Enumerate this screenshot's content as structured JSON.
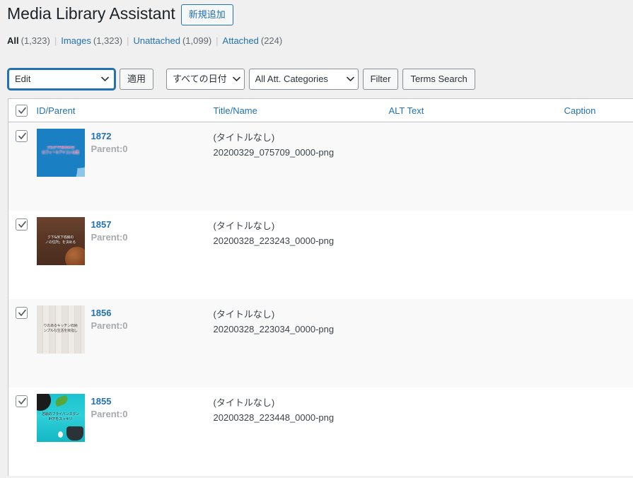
{
  "header": {
    "title": "Media Library Assistant",
    "add_new_label": "新規追加"
  },
  "status_links": {
    "items": [
      {
        "label": "All",
        "count": "(1,323)",
        "current": true
      },
      {
        "label": "Images",
        "count": "(1,323)",
        "current": false
      },
      {
        "label": "Unattached",
        "count": "(1,099)",
        "current": false
      },
      {
        "label": "Attached",
        "count": "(224)",
        "current": false
      }
    ],
    "separator": "|"
  },
  "tablenav": {
    "bulk_action": {
      "value": "Edit",
      "name": "bulk-action-select"
    },
    "apply_label": "適用",
    "date_filter": {
      "value": "すべての日付"
    },
    "category_filter": {
      "value": "All Att. Categories"
    },
    "filter_label": "Filter",
    "terms_search_label": "Terms Search"
  },
  "table": {
    "columns": [
      {
        "key": "cb",
        "label": ""
      },
      {
        "key": "id",
        "label": "ID/Parent"
      },
      {
        "key": "title",
        "label": "Title/Name"
      },
      {
        "key": "alt",
        "label": "ALT Text"
      },
      {
        "key": "caption",
        "label": "Caption"
      }
    ],
    "rows": [
      {
        "checked": true,
        "id": "1872",
        "parent": "Parent:0",
        "title": "(タイトルなし)",
        "name": "20200329_075709_0000-png",
        "alt": "",
        "caption": "",
        "thumb_class": "art-1872",
        "thumb_line1": "ブログやTwitterの",
        "thumb_line2": "ロフィールアイコンは重"
      },
      {
        "checked": true,
        "id": "1857",
        "parent": "Parent:0",
        "title": "(タイトルなし)",
        "name": "20200328_223243_0000-png",
        "alt": "",
        "caption": "",
        "thumb_class": "art-1857",
        "thumb_line1": "ク下&床下収納の",
        "thumb_line2": "ノの住所」を決める"
      },
      {
        "checked": true,
        "id": "1856",
        "parent": "Parent:0",
        "title": "(タイトルなし)",
        "name": "20200328_223034_0000-png",
        "alt": "",
        "caption": "",
        "thumb_class": "art-1856",
        "thumb_line1": "りのあるキッチン収納",
        "thumb_line2": "ンプルな生活を目指し"
      },
      {
        "checked": true,
        "id": "1855",
        "parent": "Parent:0",
        "title": "(タイトルなし)",
        "name": "20200328_223448_0000-png",
        "alt": "",
        "caption": "",
        "thumb_class": "art-1855",
        "thumb_line1": "念願のフライパンスタン",
        "thumb_line2": "IH下をスッキリ"
      }
    ],
    "select_all_checked": true
  },
  "colors": {
    "link": "#2271b1",
    "page_bg": "#f0f0f1",
    "row_alt_bg": "#f9f9f9",
    "border": "#c3c4c7",
    "muted_text": "#646970"
  }
}
